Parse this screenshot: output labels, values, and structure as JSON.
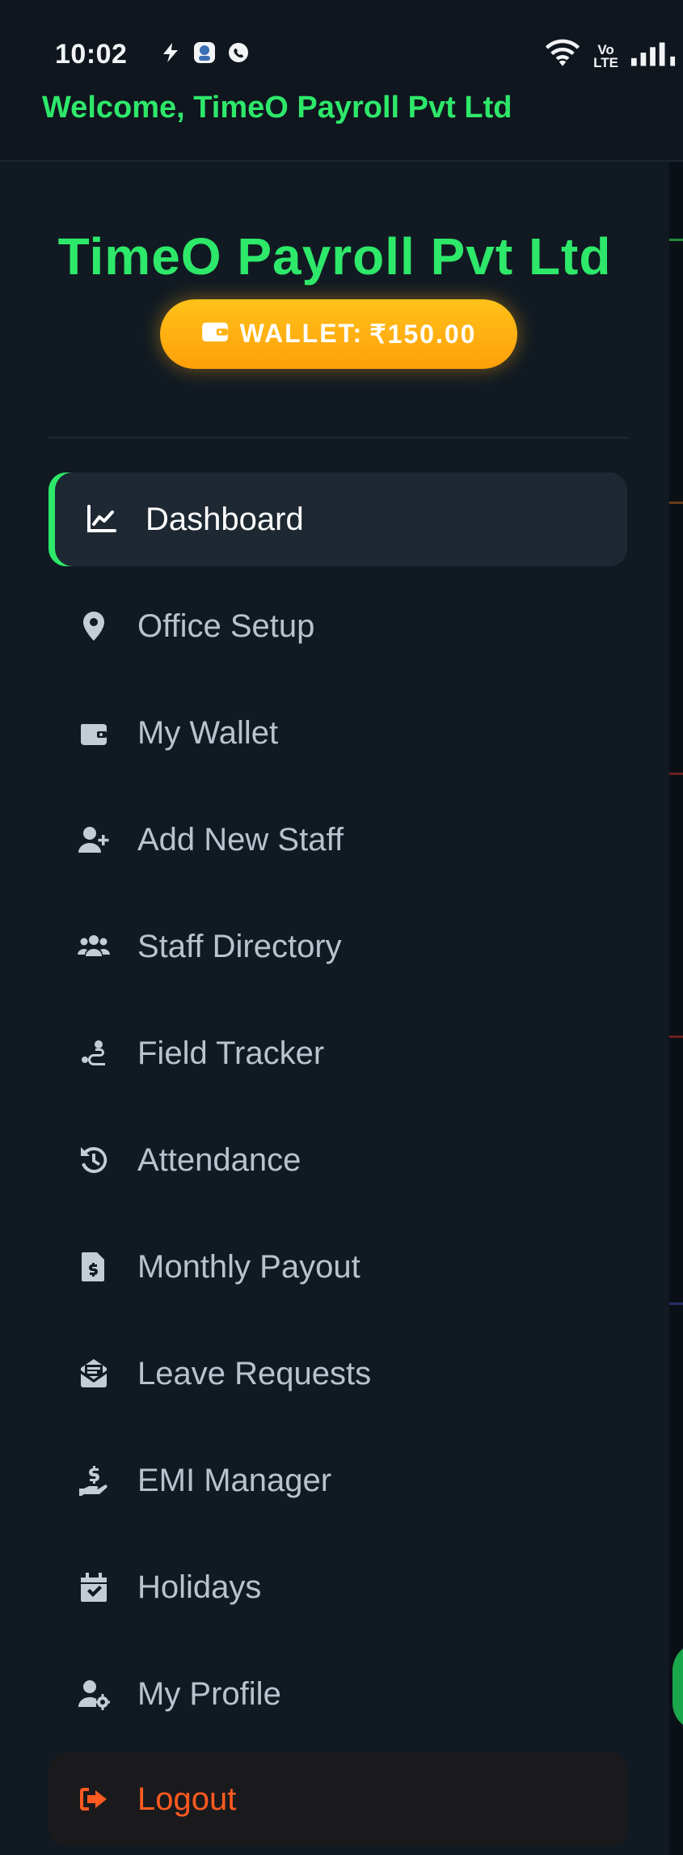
{
  "status_bar": {
    "time": "10:02",
    "network_label_top": "Vo",
    "network_label_bottom": "LTE",
    "icons": [
      "power-bolt-icon",
      "app-icon",
      "whatsapp-icon",
      "wifi-icon",
      "signal-icon"
    ]
  },
  "header": {
    "welcome_text": "Welcome, TimeO Payroll Pvt Ltd"
  },
  "drawer": {
    "company_name": "TimeO Payroll Pvt Ltd",
    "wallet": {
      "label": "WALLET:",
      "amount": "₹150.00"
    },
    "menu": [
      {
        "label": "Dashboard",
        "icon": "chart-line-icon",
        "active": true
      },
      {
        "label": "Office Setup",
        "icon": "location-pin-icon"
      },
      {
        "label": "My Wallet",
        "icon": "wallet-icon"
      },
      {
        "label": "Add New Staff",
        "icon": "user-plus-icon"
      },
      {
        "label": "Staff Directory",
        "icon": "users-icon"
      },
      {
        "label": "Field Tracker",
        "icon": "route-icon"
      },
      {
        "label": "Attendance",
        "icon": "history-icon"
      },
      {
        "label": "Monthly Payout",
        "icon": "invoice-dollar-icon"
      },
      {
        "label": "Leave Requests",
        "icon": "envelope-open-icon"
      },
      {
        "label": "EMI Manager",
        "icon": "hand-dollar-icon"
      },
      {
        "label": "Holidays",
        "icon": "calendar-check-icon"
      },
      {
        "label": "My Profile",
        "icon": "user-gear-icon"
      }
    ],
    "logout_label": "Logout"
  },
  "colors": {
    "accent": "#2ee86a",
    "wallet_gradient": [
      "#ffc21a",
      "#ff9f0a"
    ],
    "logout": "#ff5a1f",
    "background": "#111a22"
  }
}
